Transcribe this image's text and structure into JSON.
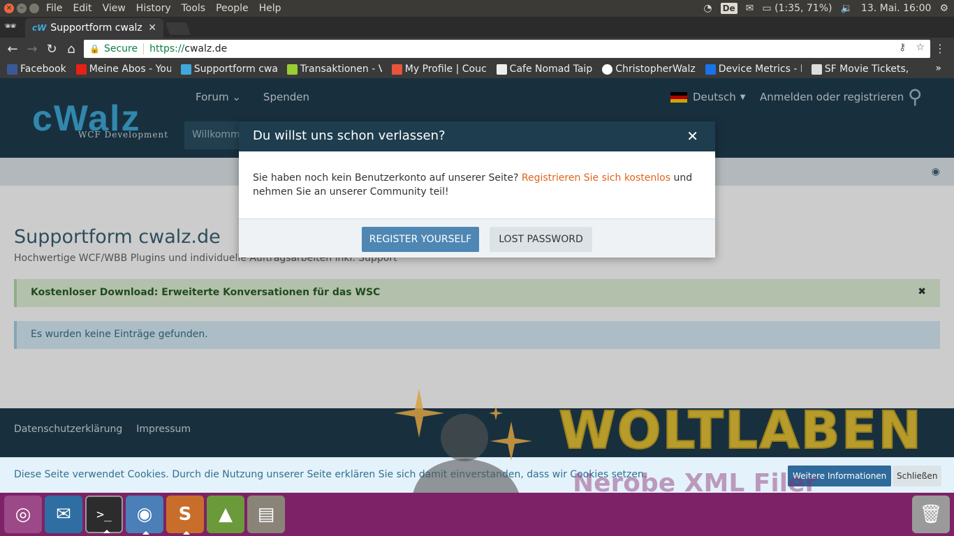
{
  "system_bar": {
    "menu": [
      "File",
      "Edit",
      "View",
      "History",
      "Tools",
      "People",
      "Help"
    ],
    "keyboard_layout": "De",
    "battery": "(1:35, 71%)",
    "clock": "13. Mai. 16:00"
  },
  "browser": {
    "tab_title": "Supportform cwalz",
    "secure_label": "Secure",
    "url_scheme": "https://",
    "url_host": "cwalz.de",
    "bookmarks": [
      {
        "label": "Facebook",
        "color": "#3b5998"
      },
      {
        "label": "Meine Abos - You",
        "color": "#e62117"
      },
      {
        "label": "Supportform cwa",
        "color": "#3fa9d9"
      },
      {
        "label": "Transaktionen - V",
        "color": "#9acd32"
      },
      {
        "label": "My Profile | Couc",
        "color": "#e8543b"
      },
      {
        "label": "Cafe Nomad Taip",
        "color": "#eeeeee"
      },
      {
        "label": "ChristopherWalz",
        "color": "#ffffff"
      },
      {
        "label": "Device Metrics - I",
        "color": "#1a73e8"
      },
      {
        "label": "SF Movie Tickets,",
        "color": "#dddddd"
      }
    ]
  },
  "site": {
    "logo": "cWalz",
    "logo_sub": "WCF Development",
    "nav": [
      "Forum",
      "Spenden"
    ],
    "language": "Deutsch",
    "login": "Anmelden oder registrieren",
    "welcome": "Willkommen",
    "page_title": "Supportform cwalz.de",
    "page_desc": "Hochwertige WCF/WBB Plugins und individuelle Auftragsarbeiten inkl. Support",
    "notice_download": "Kostenloser Download: Erweiterte Konversationen für das WSC",
    "notice_empty": "Es wurden keine Einträge gefunden.",
    "footer_links": [
      "Datenschutzerklärung",
      "Impressum"
    ],
    "cookie_text": "Diese Seite verwendet Cookies. Durch die Nutzung unserer Seite erklären Sie sich damit einverstanden, dass wir Cookies setzen.",
    "cookie_more": "Weitere Informationen",
    "cookie_close": "Schließen"
  },
  "modal": {
    "title": "Du willst uns schon verlassen?",
    "body_before": "Sie haben noch kein Benutzerkonto auf unserer Seite? ",
    "body_link": "Registrieren Sie sich kostenlos",
    "body_after": " und nehmen Sie an unserer Community teil!",
    "register_button": "REGISTER YOURSELF",
    "lost_password_button": "LOST PASSWORD"
  },
  "watermark": {
    "title": "WOLTLABEN",
    "subtitle": "Nerobe XML Filer"
  },
  "colors": {
    "header": "#1e3d4e",
    "accent_link": "#e0641b",
    "primary_button": "#4f87b4",
    "launcher": "#7d2266"
  },
  "launcher": {
    "apps": [
      "ubuntu-icon",
      "thunderbird-icon",
      "terminal-icon",
      "chrome-icon",
      "sublime-text-icon",
      "android-studio-icon",
      "files-icon",
      "trash-icon"
    ]
  }
}
